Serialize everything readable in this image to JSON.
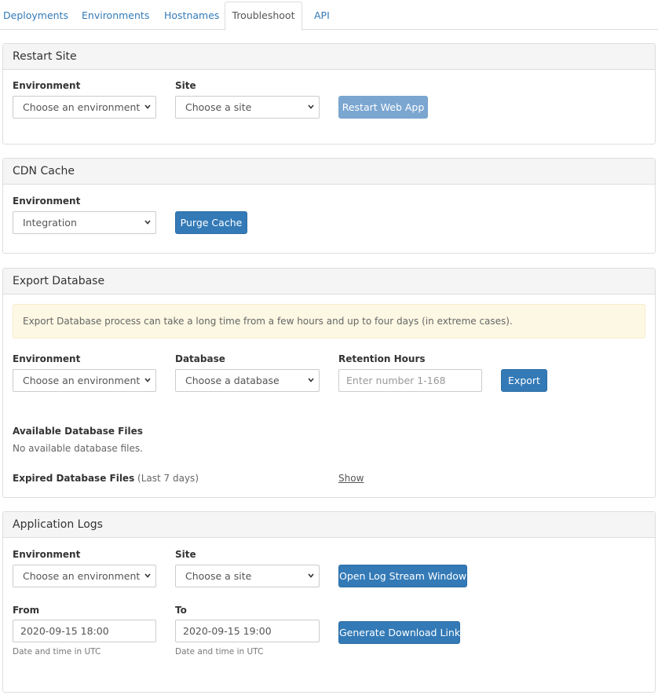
{
  "tabs": {
    "deployments": "Deployments",
    "environments": "Environments",
    "hostnames": "Hostnames",
    "troubleshoot": "Troubleshoot",
    "api": "API"
  },
  "restart_site": {
    "title": "Restart Site",
    "environment_label": "Environment",
    "environment_value": "Choose an environment",
    "site_label": "Site",
    "site_value": "Choose a site",
    "button": "Restart Web App"
  },
  "cdn_cache": {
    "title": "CDN Cache",
    "environment_label": "Environment",
    "environment_value": "Integration",
    "button": "Purge Cache"
  },
  "export_database": {
    "title": "Export Database",
    "notice": "Export Database process can take a long time from a few hours and up to four days (in extreme cases).",
    "environment_label": "Environment",
    "environment_value": "Choose an environment",
    "database_label": "Database",
    "database_value": "Choose a database",
    "retention_label": "Retention Hours",
    "retention_placeholder": "Enter number 1-168",
    "button": "Export",
    "available_label": "Available Database Files",
    "available_empty": "No available database files.",
    "expired_label": "Expired Database Files",
    "expired_suffix": "(Last 7 days)",
    "show_link": "Show"
  },
  "application_logs": {
    "title": "Application Logs",
    "environment_label": "Environment",
    "environment_value": "Choose an environment",
    "site_label": "Site",
    "site_value": "Choose a site",
    "stream_button": "Open Log Stream Window",
    "from_label": "From",
    "from_value": "2020-09-15 18:00",
    "to_label": "To",
    "to_value": "2020-09-15 19:00",
    "utc_note_from": "Date and time in UTC",
    "utc_note_to": "Date and time in UTC",
    "download_button": "Generate Download Link"
  },
  "colors": {
    "primary": "#337ab7",
    "primary_disabled": "#7aa6d0",
    "warning_bg": "#fcf8e3",
    "panel_heading_bg": "#f5f5f5"
  }
}
